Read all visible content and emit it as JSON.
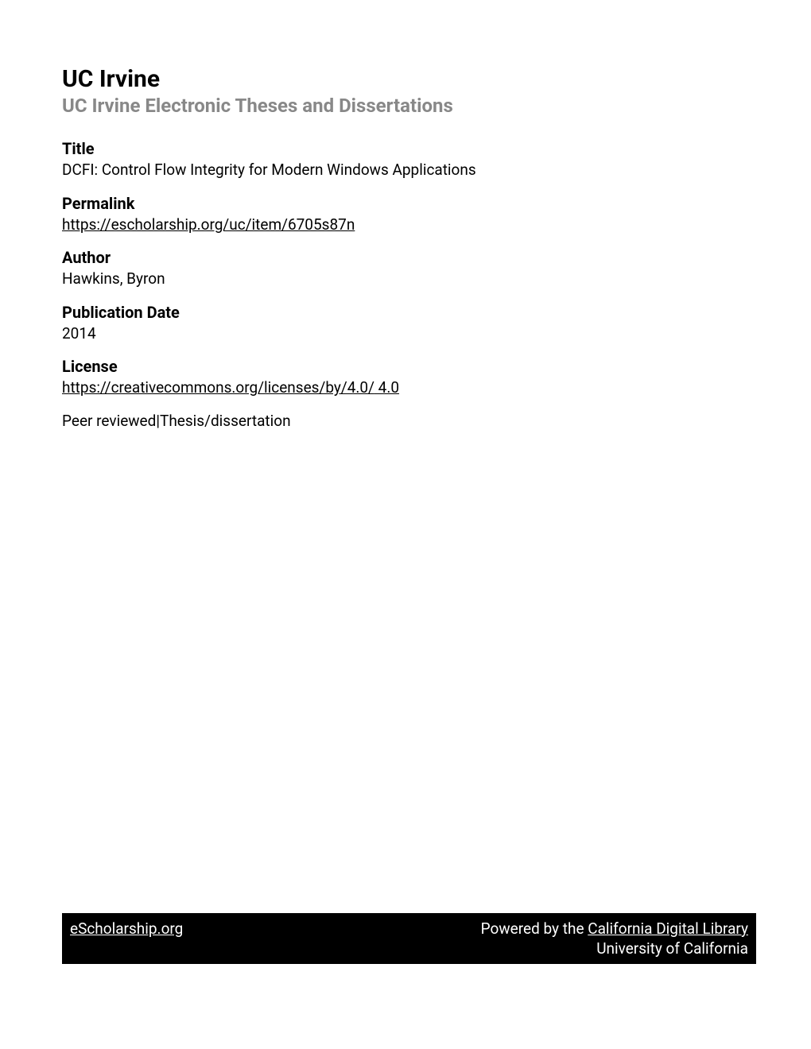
{
  "header": {
    "institution": "UC Irvine",
    "series": "UC Irvine Electronic Theses and Dissertations"
  },
  "fields": {
    "title_label": "Title",
    "title_value": "DCFI: Control Flow Integrity for Modern Windows Applications",
    "permalink_label": "Permalink",
    "permalink_value": "https://escholarship.org/uc/item/6705s87n",
    "author_label": "Author",
    "author_value": "Hawkins, Byron",
    "pubdate_label": "Publication Date",
    "pubdate_value": "2014",
    "license_label": "License",
    "license_url": "https://creativecommons.org/licenses/by/4.0/",
    "license_version": " 4.0"
  },
  "peer_review": "Peer reviewed|Thesis/dissertation",
  "footer": {
    "escholarship": "eScholarship.org",
    "powered_by": "Powered by the ",
    "cdl": "California Digital Library",
    "uc": "University of California"
  }
}
